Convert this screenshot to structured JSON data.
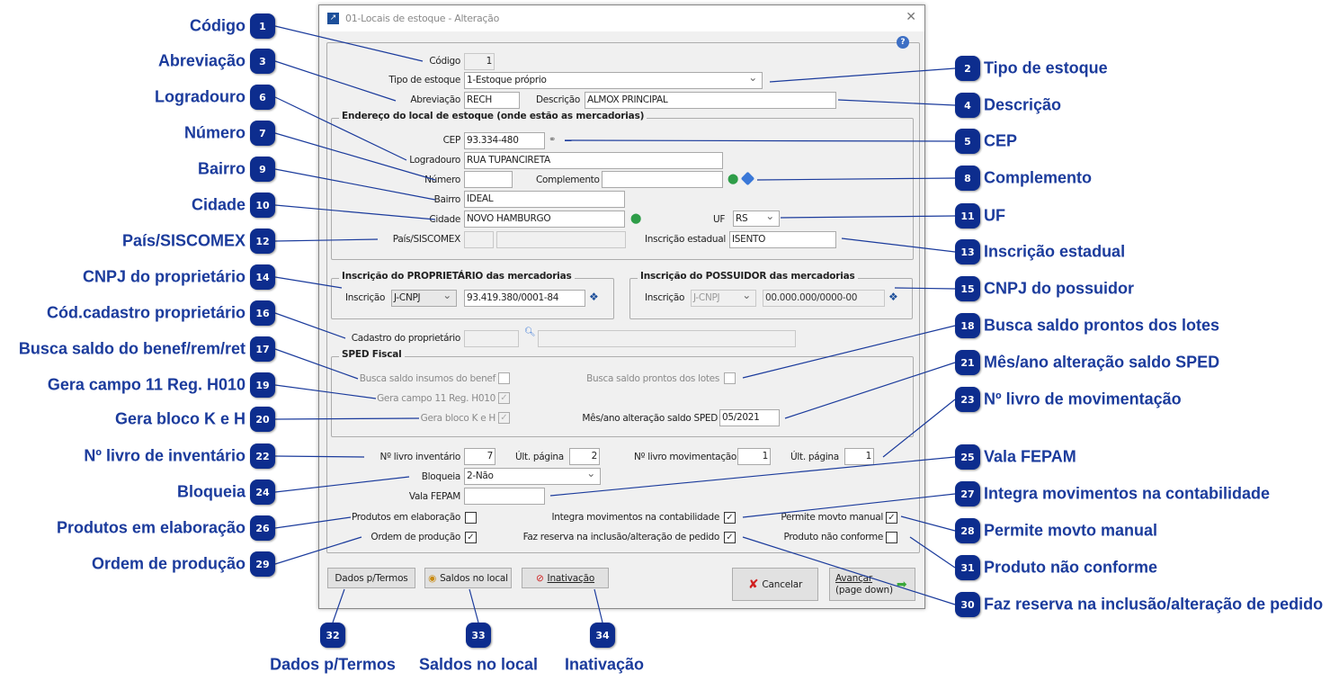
{
  "window": {
    "title": "01-Locais de estoque - Alteração",
    "close": "✕",
    "help": "?"
  },
  "form": {
    "codigo": {
      "label": "Código",
      "value": "1"
    },
    "tipo": {
      "label": "Tipo de estoque",
      "value": "1-Estoque próprio"
    },
    "abrev": {
      "label": "Abreviação",
      "value": "RECH"
    },
    "descricao": {
      "label": "Descrição",
      "value": "ALMOX PRINCIPAL"
    },
    "endereco_group": "Endereço do local de estoque (onde estão as mercadorias)",
    "cep": {
      "label": "CEP",
      "value": "93.334-480"
    },
    "logradouro": {
      "label": "Logradouro",
      "value": "RUA TUPANCIRETA"
    },
    "numero": {
      "label": "Número",
      "value": ""
    },
    "complemento": {
      "label": "Complemento",
      "value": ""
    },
    "bairro": {
      "label": "Bairro",
      "value": "IDEAL"
    },
    "cidade": {
      "label": "Cidade",
      "value": "NOVO HAMBURGO"
    },
    "uf": {
      "label": "UF",
      "value": "RS"
    },
    "pais": {
      "label": "País/SISCOMEX",
      "value": ""
    },
    "ie": {
      "label": "Inscrição estadual",
      "value": "ISENTO"
    },
    "prop_group": "Inscrição do PROPRIETÁRIO das mercadorias",
    "prop": {
      "label": "Inscrição",
      "type": "J-CNPJ",
      "value": "93.419.380/0001-84"
    },
    "poss_group": "Inscrição do POSSUIDOR das mercadorias",
    "poss": {
      "label": "Inscrição",
      "type": "J-CNPJ",
      "value": "00.000.000/0000-00"
    },
    "cadastro": {
      "label": "Cadastro do proprietário",
      "value": ""
    },
    "sped_group": "SPED Fiscal",
    "busca_benef": {
      "label": "Busca saldo insumos do benef",
      "checked": false
    },
    "busca_lotes": {
      "label": "Busca saldo prontos dos lotes",
      "checked": false
    },
    "gera11": {
      "label": "Gera campo 11 Reg. H010",
      "checked": true
    },
    "gerak": {
      "label": "Gera bloco K e H",
      "checked": true
    },
    "mesano": {
      "label": "Mês/ano alteração saldo SPED",
      "value": "05/2021"
    },
    "livro_inv": {
      "label": "Nº livro inventário",
      "value": "7"
    },
    "ult_pag_inv": {
      "label": "Últ. página",
      "value": "2"
    },
    "livro_mov": {
      "label": "Nº livro movimentação",
      "value": "1"
    },
    "ult_pag_mov": {
      "label": "Últ. página",
      "value": "1"
    },
    "bloqueia": {
      "label": "Bloqueia",
      "value": "2-Não"
    },
    "vala": {
      "label": "Vala FEPAM",
      "value": ""
    },
    "prod_elab": {
      "label": "Produtos em elaboração",
      "checked": false
    },
    "integra": {
      "label": "Integra movimentos na contabilidade",
      "checked": true
    },
    "permite": {
      "label": "Permite movto manual",
      "checked": true
    },
    "ordem": {
      "label": "Ordem de produção",
      "checked": true
    },
    "reserva": {
      "label": "Faz reserva na inclusão/alteração de pedido",
      "checked": true
    },
    "nao_conforme": {
      "label": "Produto não conforme",
      "checked": false
    }
  },
  "buttons": {
    "dados": "Dados p/Termos",
    "saldos": "Saldos no local",
    "inativacao": "Inativação",
    "cancelar": "Cancelar",
    "avancar1": "Avançar",
    "avancar2": "(page down)"
  },
  "check_mark": "✓",
  "callouts": [
    {
      "n": "1",
      "label": "Código"
    },
    {
      "n": "2",
      "label": "Tipo de estoque"
    },
    {
      "n": "3",
      "label": "Abreviação"
    },
    {
      "n": "4",
      "label": "Descrição"
    },
    {
      "n": "5",
      "label": "CEP"
    },
    {
      "n": "6",
      "label": "Logradouro"
    },
    {
      "n": "7",
      "label": "Número"
    },
    {
      "n": "8",
      "label": "Complemento"
    },
    {
      "n": "9",
      "label": "Bairro"
    },
    {
      "n": "10",
      "label": "Cidade"
    },
    {
      "n": "11",
      "label": "UF"
    },
    {
      "n": "12",
      "label": "País/SISCOMEX"
    },
    {
      "n": "13",
      "label": "Inscrição estadual"
    },
    {
      "n": "14",
      "label": "CNPJ do proprietário"
    },
    {
      "n": "15",
      "label": "CNPJ do possuidor"
    },
    {
      "n": "16",
      "label": "Cód.cadastro proprietário"
    },
    {
      "n": "17",
      "label": "Busca saldo do benef/rem/ret"
    },
    {
      "n": "18",
      "label": "Busca saldo prontos dos lotes"
    },
    {
      "n": "19",
      "label": "Gera campo 11 Reg. H010"
    },
    {
      "n": "20",
      "label": "Gera bloco K e H"
    },
    {
      "n": "21",
      "label": "Mês/ano alteração saldo SPED"
    },
    {
      "n": "22",
      "label": "Nº livro de inventário"
    },
    {
      "n": "23",
      "label": "Nº livro de movimentação"
    },
    {
      "n": "24",
      "label": "Bloqueia"
    },
    {
      "n": "25",
      "label": "Vala FEPAM"
    },
    {
      "n": "26",
      "label": "Produtos em elaboração"
    },
    {
      "n": "27",
      "label": "Integra movimentos na contabilidade"
    },
    {
      "n": "28",
      "label": "Permite movto manual"
    },
    {
      "n": "29",
      "label": "Ordem de produção"
    },
    {
      "n": "30",
      "label": "Faz reserva na inclusão/alteração de pedido"
    },
    {
      "n": "31",
      "label": "Produto não conforme"
    },
    {
      "n": "32",
      "label": "Dados p/Termos"
    },
    {
      "n": "33",
      "label": "Saldos no local"
    },
    {
      "n": "34",
      "label": "Inativação"
    }
  ],
  "colors": {
    "badge": "#0d2d8e",
    "callout_text": "#1b3b9c",
    "line": "#1b3b9c"
  }
}
